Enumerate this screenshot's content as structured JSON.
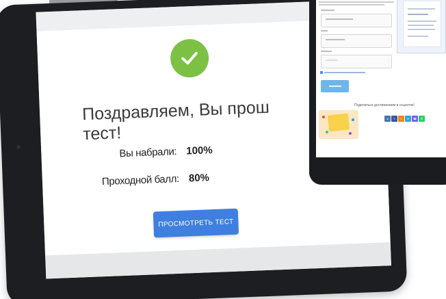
{
  "result": {
    "congrats_text_line1": "Поздравляем, Вы прош",
    "congrats_text_line2": "тест!",
    "score_label": "Вы набрали:",
    "score_value": "100%",
    "passing_label": "Проходной балл:",
    "passing_value": "80%",
    "view_test_button": "ПРОСМОТРЕТЬ ТЕСТ"
  },
  "second_device": {
    "share_text": "Поделиться достижением в соцсетях!"
  },
  "colors": {
    "accent_blue": "#3f7fe0",
    "success_green": "#7cc143",
    "device_frame": "#1d1e22"
  },
  "icons": {
    "success": "check-icon",
    "social": [
      "vk-icon",
      "facebook-icon",
      "odnoklassniki-icon",
      "telegram-icon",
      "viber-icon",
      "whatsapp-icon"
    ]
  }
}
